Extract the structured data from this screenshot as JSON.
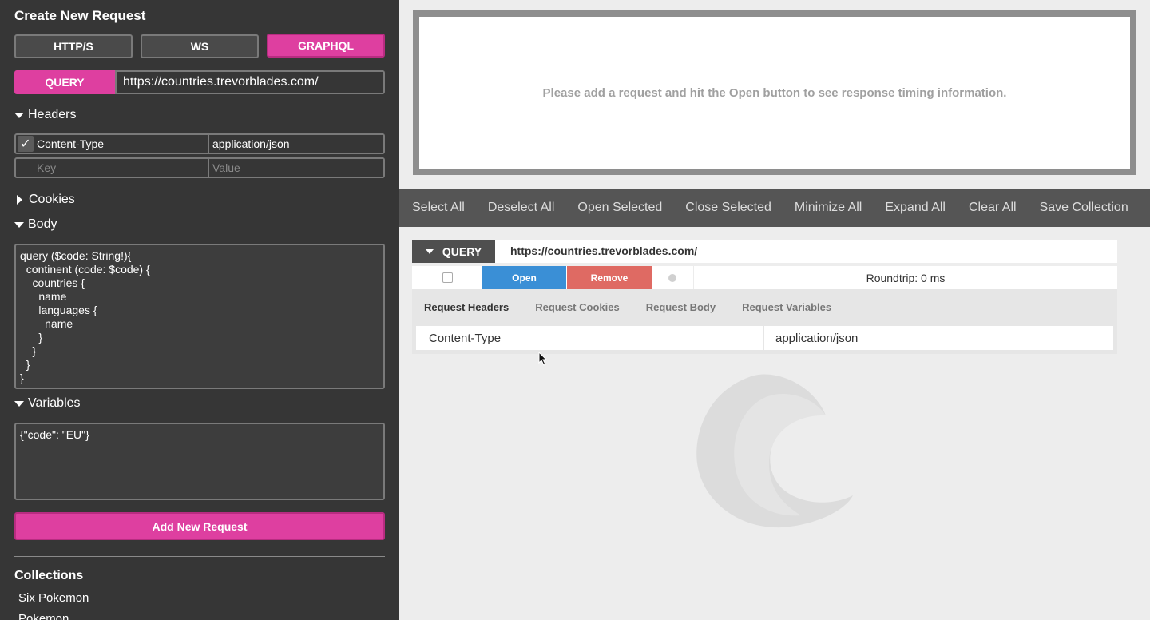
{
  "sidebar": {
    "title": "Create New Request",
    "protocols": [
      "HTTP/S",
      "WS",
      "GRAPHQL"
    ],
    "active_protocol": "GRAPHQL",
    "method": "QUERY",
    "url": "https://countries.trevorblades.com/",
    "headers_label": "Headers",
    "headers": [
      {
        "key": "Content-Type",
        "value": "application/json",
        "checked": true
      }
    ],
    "header_key_placeholder": "Key",
    "header_value_placeholder": "Value",
    "cookies_label": "Cookies",
    "body_label": "Body",
    "body": "query ($code: String!){\n  continent (code: $code) {\n    countries {\n      name\n      languages {\n        name\n      }\n    }\n  }\n}",
    "variables_label": "Variables",
    "variables": "{\"code\": \"EU\"}",
    "add_button": "Add New Request",
    "collections_label": "Collections",
    "collections": [
      "Six Pokemon",
      "Pokemon"
    ]
  },
  "main": {
    "timing_message": "Please add a request and hit the Open button to see response timing information.",
    "toolbar": [
      "Select All",
      "Deselect All",
      "Open Selected",
      "Close Selected",
      "Minimize All",
      "Expand All",
      "Clear All",
      "Save Collection"
    ],
    "request": {
      "method": "QUERY",
      "url": "https://countries.trevorblades.com/",
      "open_label": "Open",
      "remove_label": "Remove",
      "roundtrip": "Roundtrip: 0 ms",
      "tabs": [
        "Request Headers",
        "Request Cookies",
        "Request Body",
        "Request Variables"
      ],
      "active_tab": "Request Headers",
      "headers": [
        {
          "key": "Content-Type",
          "value": "application/json"
        }
      ]
    }
  },
  "colors": {
    "accent": "#de3fa0",
    "open": "#3a8fd6",
    "remove": "#df6a63",
    "sidebar_bg": "#363636"
  }
}
